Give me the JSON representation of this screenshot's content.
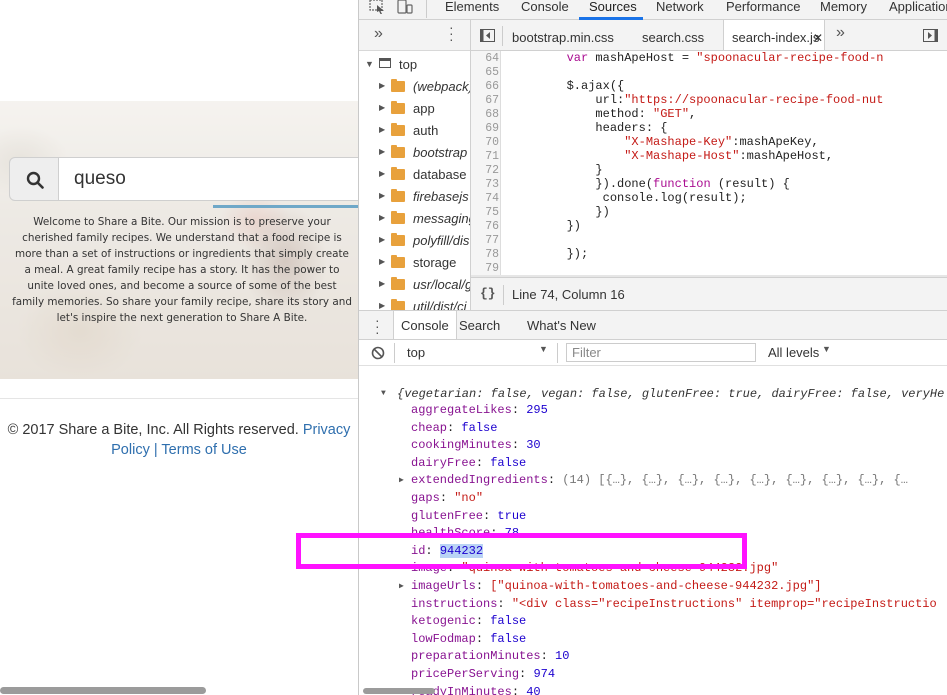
{
  "page": {
    "search": {
      "value": "queso"
    },
    "welcome_text": "Welcome to Share a Bite. Our mission is to preserve your cherished family recipes. We understand that a food recipe is more than a set of instructions or ingredients that simply create a meal. A great family recipe has a story. It has the power to unite loved ones, and become a source of some of the best family memories. So share your family recipe, share its story and let's inspire the next generation to Share A Bite.",
    "footer": {
      "copyright": "© 2017 Share a Bite, Inc. All Rights reserved.",
      "privacy_link": "Privacy Policy",
      "separator": "|",
      "terms_link": "Terms of Use"
    }
  },
  "devtools": {
    "main_tabs": [
      "Elements",
      "Console",
      "Sources",
      "Network",
      "Performance",
      "Memory",
      "Application"
    ],
    "active_main_tab": "Sources",
    "navigator": {
      "more_icon": "»",
      "root": "top",
      "items": [
        "(webpack)",
        "app",
        "auth",
        "bootstrap",
        "database",
        "firebasejs",
        "messaging",
        "polyfill/dist",
        "storage",
        "usr/local/g",
        "util/dist/cj"
      ]
    },
    "editor_tabs": [
      "bootstrap.min.css",
      "search.css",
      "search-index.js"
    ],
    "active_editor_tab": "search-index.js",
    "code_lines": [
      {
        "n": "64",
        "t": "        var mashApeHost = \"spoonacular-recipe-food-n"
      },
      {
        "n": "65",
        "t": ""
      },
      {
        "n": "66",
        "t": "        $.ajax({"
      },
      {
        "n": "67",
        "t": "            url:\"https://spoonacular-recipe-food-nut"
      },
      {
        "n": "68",
        "t": "            method: \"GET\","
      },
      {
        "n": "69",
        "t": "            headers: {"
      },
      {
        "n": "70",
        "t": "                \"X-Mashape-Key\":mashApeKey,"
      },
      {
        "n": "71",
        "t": "                \"X-Mashape-Host\":mashApeHost,"
      },
      {
        "n": "72",
        "t": "            }"
      },
      {
        "n": "73",
        "t": "            }).done(function (result) {"
      },
      {
        "n": "74",
        "t": "             console.log(result);"
      },
      {
        "n": "75",
        "t": "            })"
      },
      {
        "n": "76",
        "t": "        })"
      },
      {
        "n": "77",
        "t": ""
      },
      {
        "n": "78",
        "t": "        });"
      },
      {
        "n": "79",
        "t": ""
      }
    ],
    "status": "Line 74, Column 16",
    "drawer_tabs": [
      "Console",
      "Search",
      "What's New"
    ],
    "active_drawer_tab": "Console",
    "console_toolbar": {
      "context": "top",
      "filter_placeholder": "Filter",
      "levels": "All levels"
    },
    "object_summary": "{vegetarian: false, vegan: false, glutenFree: true, dairyFree: false, veryHe",
    "properties": [
      {
        "key": "aggregateLikes",
        "value": "295",
        "type": "num"
      },
      {
        "key": "cheap",
        "value": "false",
        "type": "bool"
      },
      {
        "key": "cookingMinutes",
        "value": "30",
        "type": "num"
      },
      {
        "key": "dairyFree",
        "value": "false",
        "type": "bool"
      },
      {
        "key": "extendedIngredients",
        "value": "(14) [{…}, {…}, {…}, {…}, {…}, {…}, {…}, {…}, {…",
        "type": "arr",
        "expandable": true
      },
      {
        "key": "gaps",
        "value": "\"no\"",
        "type": "str"
      },
      {
        "key": "glutenFree",
        "value": "true",
        "type": "bool"
      },
      {
        "key": "healthScore",
        "value": "78",
        "type": "num"
      },
      {
        "key": "id",
        "value": "944232",
        "type": "num",
        "selected": true
      },
      {
        "key": "image",
        "value": "\"quinoa-with-tomatoes-and-cheese-944232.jpg\"",
        "type": "str"
      },
      {
        "key": "imageUrls",
        "value": "[\"quinoa-with-tomatoes-and-cheese-944232.jpg\"]",
        "type": "arr-str",
        "expandable": true
      },
      {
        "key": "instructions",
        "value": "\"<div class=\"recipeInstructions\" itemprop=\"recipeInstructio",
        "type": "str"
      },
      {
        "key": "ketogenic",
        "value": "false",
        "type": "bool"
      },
      {
        "key": "lowFodmap",
        "value": "false",
        "type": "bool"
      },
      {
        "key": "preparationMinutes",
        "value": "10",
        "type": "num"
      },
      {
        "key": "pricePerServing",
        "value": "974",
        "type": "num"
      },
      {
        "key": "readyInMinutes",
        "value": "40",
        "type": "num"
      }
    ],
    "colors": {
      "highlight": "#ff12ff",
      "accent": "#1a73e8"
    }
  }
}
